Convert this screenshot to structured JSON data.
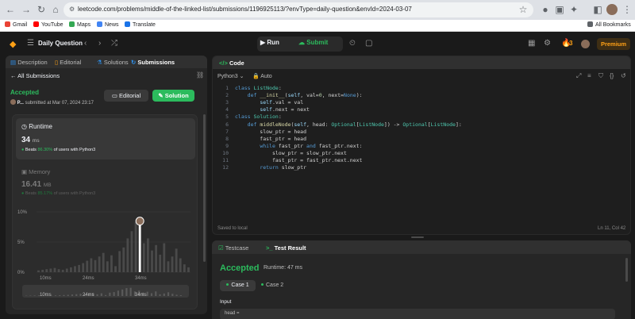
{
  "browser": {
    "url": "leetcode.com/problems/middle-of-the-linked-list/submissions/1196925113/?envType=daily-question&envId=2024-03-07",
    "bookmarks": [
      "Gmail",
      "YouTube",
      "Maps",
      "News",
      "Translate"
    ],
    "all_bookmarks": "All Bookmarks"
  },
  "header": {
    "title": "Daily Question",
    "run": "Run",
    "submit": "Submit",
    "streak": "3",
    "premium": "Premium"
  },
  "left_tabs": [
    "Description",
    "Editorial",
    "Solutions",
    "Submissions"
  ],
  "submission": {
    "back_label": "All Submissions",
    "status": "Accepted",
    "user": "P...",
    "submitted_at": "submitted at Mar 07, 2024 23:17",
    "editorial_btn": "Editorial",
    "solution_btn": "Solution",
    "runtime_label": "Runtime",
    "runtime_value": "34",
    "runtime_unit": "ms",
    "runtime_beats_prefix": "Beats",
    "runtime_beats_pct": "86.30%",
    "runtime_beats_suffix": "of users with Python3",
    "memory_label": "Memory",
    "memory_value": "16.41",
    "memory_unit": "MB",
    "memory_beats_prefix": "Beats",
    "memory_beats_pct": "85.17%",
    "memory_beats_suffix": "of users with Python3"
  },
  "chart_data": {
    "type": "bar",
    "yticks": [
      "10%",
      "5%",
      "0%"
    ],
    "xticks": [
      "10ms",
      "24ms",
      "34ms"
    ],
    "values": [
      0.3,
      0.4,
      0.5,
      0.6,
      0.7,
      0.5,
      0.4,
      0.6,
      0.8,
      1.0,
      1.2,
      1.5,
      1.9,
      2.3,
      2.0,
      2.6,
      3.2,
      1.8,
      2.8,
      1.0,
      3.5,
      4.1,
      5.6,
      6.8,
      8.3,
      8.6,
      4.8,
      5.6,
      3.6,
      4.5,
      2.9,
      4.8,
      1.8,
      2.6,
      3.9,
      2.3,
      1.3,
      0.8
    ],
    "highlight_index": 25,
    "ylim": [
      0,
      10
    ]
  },
  "code": {
    "title": "Code",
    "language": "Python3",
    "mode": "Auto",
    "saved": "Saved to local",
    "cursor": "Ln 11, Col 42",
    "lines": [
      "class ListNode:",
      "    def __init__(self, val=0, next=None):",
      "        self.val = val",
      "        self.next = next",
      "class Solution:",
      "    def middleNode(self, head: Optional[ListNode]) -> Optional[ListNode]:",
      "        slow_ptr = head",
      "        fast_ptr = head",
      "        while fast_ptr and fast_ptr.next:",
      "            slow_ptr = slow_ptr.next",
      "            fast_ptr = fast_ptr.next.next",
      "        return slow_ptr"
    ]
  },
  "result": {
    "testcase_tab": "Testcase",
    "result_tab": "Test Result",
    "status": "Accepted",
    "runtime": "Runtime: 47 ms",
    "case1": "Case 1",
    "case2": "Case 2",
    "input_label": "Input",
    "input_value": "head ="
  },
  "colors": {
    "accent_green": "#2cbb5d",
    "premium_orange": "#ffa116"
  }
}
